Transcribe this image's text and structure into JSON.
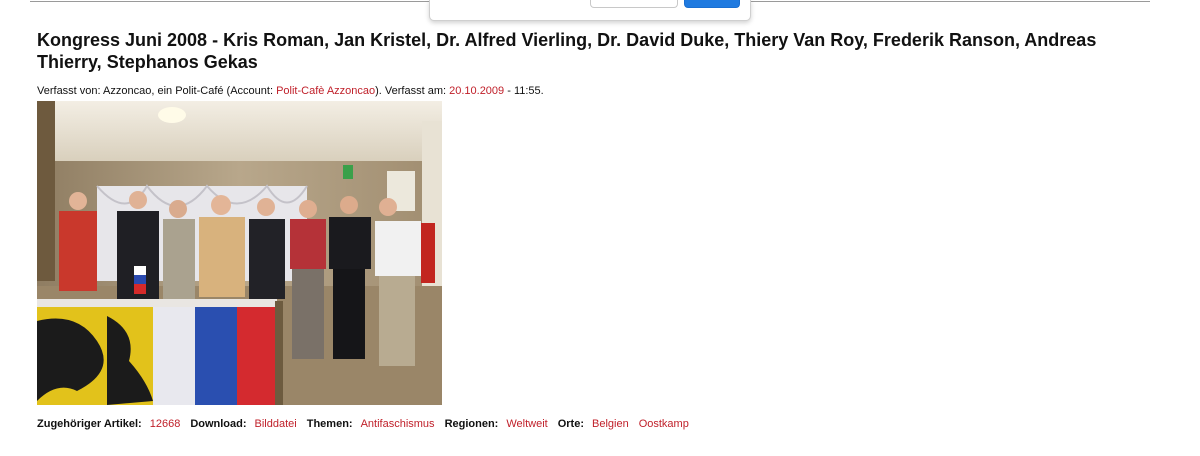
{
  "article": {
    "title": "Kongress Juni 2008 - Kris Roman, Jan Kristel, Dr. Alfred Vierling, Dr. David Duke, Thiery Van Roy, Frederik Ranson, Andreas Thierry, Stephanos Gekas",
    "meta": {
      "author_prefix": "Verfasst von: Azzoncao, ein Polit-Café (Account: ",
      "account_link": "Polit-Cafè Azzoncao",
      "date_prefix": "). Verfasst am: ",
      "date_link": "20.10.2009",
      "time_suffix": " - 11:55."
    }
  },
  "footer": {
    "related_label": "Zugehöriger Artikel:",
    "related_value": "12668",
    "download_label": "Download:",
    "download_value": "Bilddatei",
    "topics_label": "Themen:",
    "topics_value": "Antifaschismus",
    "regions_label": "Regionen:",
    "regions_value": "Weltweit",
    "places_label": "Orte:",
    "places_values": [
      "Belgien",
      "Oostkamp"
    ]
  },
  "colors": {
    "link": "#c0202a",
    "dialog_primary": "#1f7ae0"
  }
}
